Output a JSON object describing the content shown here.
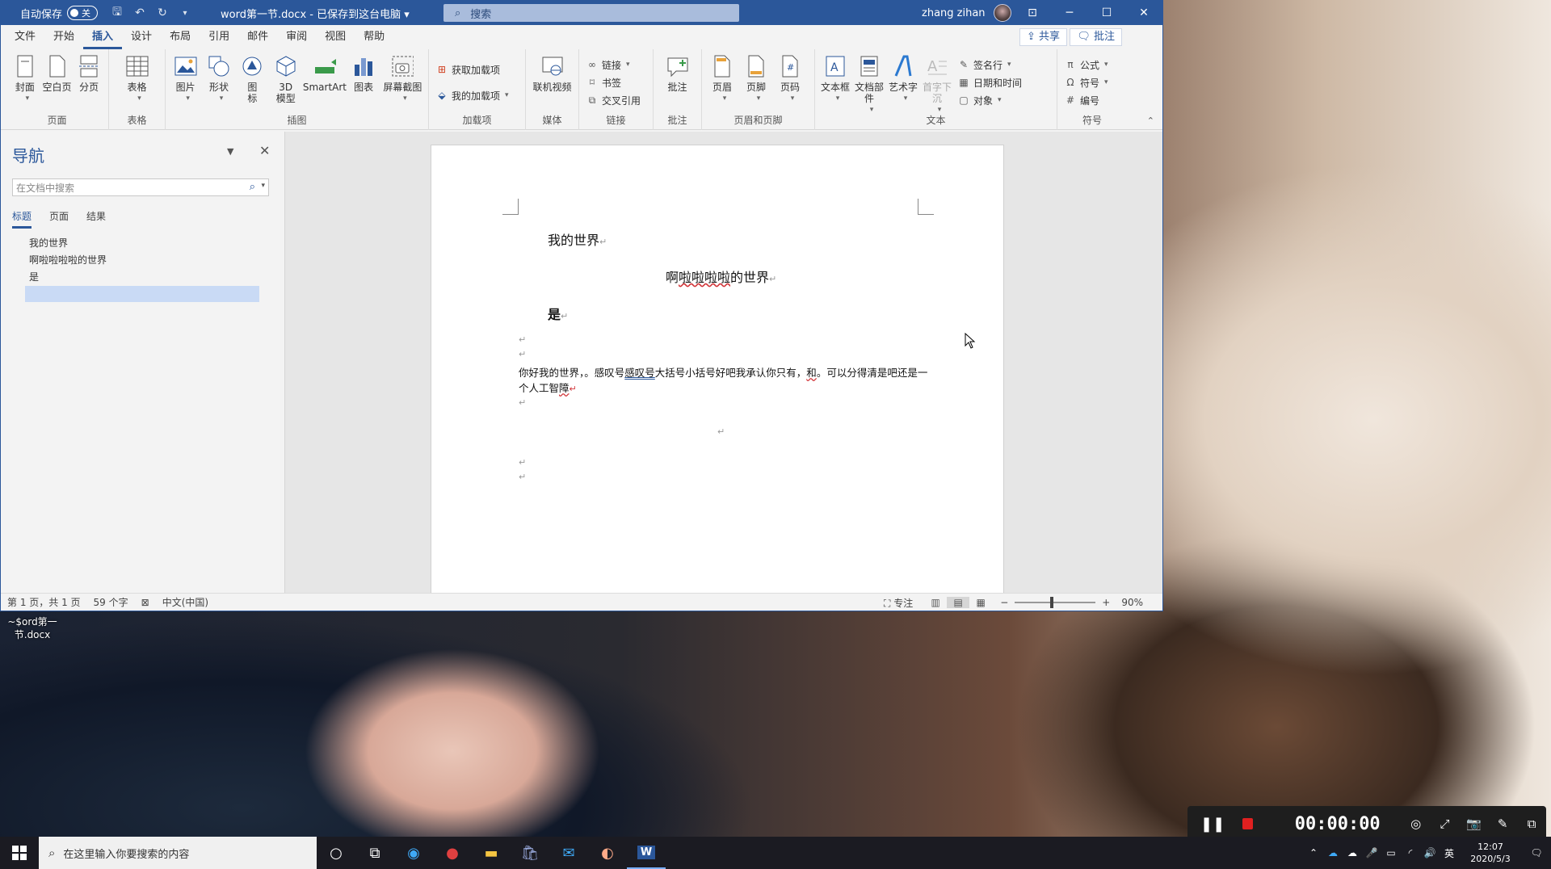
{
  "window": {
    "autosave_label": "自动保存",
    "autosave_state": "关",
    "doc_title": "word第一节.docx - 已保存到这台电脑",
    "search_placeholder": "搜索",
    "user_name": "zhang zihan"
  },
  "menu": {
    "tabs": [
      "文件",
      "开始",
      "插入",
      "设计",
      "布局",
      "引用",
      "邮件",
      "审阅",
      "视图",
      "帮助"
    ],
    "active_tab": "插入",
    "share": "共享",
    "comment": "批注"
  },
  "ribbon": {
    "pages": {
      "cover": "封面",
      "blank": "空白页",
      "break": "分页",
      "label": "页面"
    },
    "tables": {
      "table": "表格",
      "label": "表格"
    },
    "illustrations": {
      "picture": "图片",
      "shapes": "形状",
      "icons": "图\n标",
      "model3d": "3D\n模型",
      "smartart": "SmartArt",
      "chart": "图表",
      "screenshot": "屏幕截图",
      "label": "插图"
    },
    "addins": {
      "get": "获取加载项",
      "mine": "我的加载项",
      "label": "加载项"
    },
    "media": {
      "video": "联机视频",
      "label": "媒体"
    },
    "links": {
      "link": "链接",
      "bookmark": "书签",
      "crossref": "交叉引用",
      "label": "链接"
    },
    "comments": {
      "comment": "批注",
      "label": "批注"
    },
    "header_footer": {
      "header": "页眉",
      "footer": "页脚",
      "page_number": "页码",
      "label": "页眉和页脚"
    },
    "text": {
      "textbox": "文本框",
      "quickparts": "文档部件",
      "wordart": "艺术字",
      "dropcap": "首字下沉",
      "signature": "签名行",
      "datetime": "日期和时间",
      "object": "对象",
      "label": "文本"
    },
    "symbols": {
      "equation": "公式",
      "symbol": "符号",
      "number": "编号",
      "label": "符号"
    }
  },
  "nav": {
    "title": "导航",
    "search_placeholder": "在文档中搜索",
    "tabs": [
      "标题",
      "页面",
      "结果"
    ],
    "items": [
      "我的世界",
      "啊啦啦啦啦的世界",
      "是",
      ""
    ]
  },
  "document": {
    "heading1": "我的世界",
    "heading2_pre": "啊",
    "heading2_squiggle": "啦啦啦啦",
    "heading2_post": "的世界",
    "heading3": "是",
    "body_a": "你好我的世界，。感叹号",
    "body_ul": "感叹号",
    "body_b": "大括号小括号好吧我承认你只有，",
    "body_sq": "和",
    "body_c": "。可以分得清是吧还是一个人工智",
    "body_sq2": "障",
    "para_mark": "↵"
  },
  "status": {
    "page": "第 1 页，共 1 页",
    "words": "59 个字",
    "lang": "中文(中国)",
    "focus": "专注",
    "zoom": "90%"
  },
  "desktop_file": "~$ord第一节.docx",
  "recorder": {
    "time": "00:00:00"
  },
  "taskbar": {
    "search_placeholder": "在这里输入你要搜索的内容",
    "time": "12:07",
    "date": "2020/5/3",
    "ime": "英"
  }
}
